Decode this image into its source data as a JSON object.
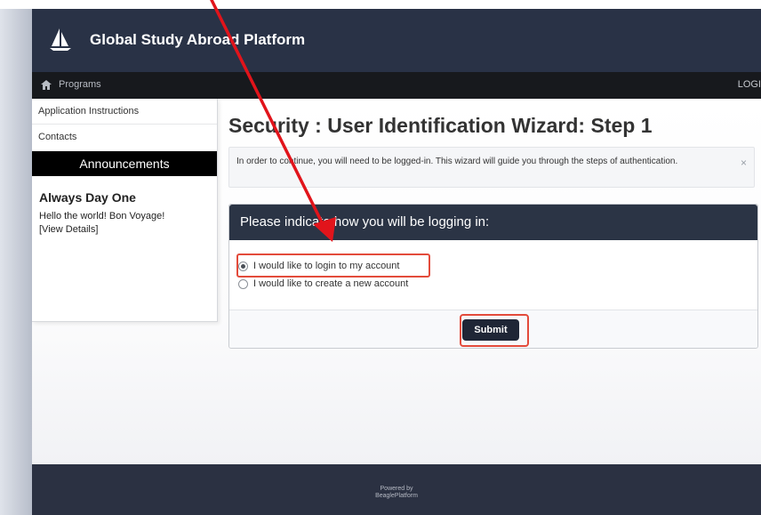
{
  "header": {
    "site_title": "Global Study Abroad Platform"
  },
  "navbar": {
    "programs_label": "Programs",
    "login_label": "LOGI"
  },
  "sidebar": {
    "links": [
      "Application Instructions",
      "Contacts"
    ],
    "announcements_heading": "Announcements",
    "announcement_title": "Always Day One",
    "announcement_text": "Hello the world! Bon Voyage!",
    "announcement_link": "[View Details]"
  },
  "main": {
    "page_title": "Security : User Identification Wizard: Step 1",
    "info_text": "In order to continue, you will need to be logged-in. This wizard will guide you through the steps of authentication.",
    "close_glyph": "×",
    "panel_heading": "Please indicate how you will be logging in:",
    "options": [
      {
        "label": "I would like to login to my account",
        "selected": true
      },
      {
        "label": "I would like to create a new account",
        "selected": false
      }
    ],
    "submit_label": "Submit"
  },
  "footer": {
    "powered_by": "Powered by",
    "platform": "BeaglePlatform"
  },
  "colors": {
    "header_bg": "#293246",
    "accent_red": "#e34b3b",
    "arrow_red": "#e1141b"
  },
  "icons": {
    "logo": "sailboat-logo-icon",
    "home": "home-icon"
  }
}
